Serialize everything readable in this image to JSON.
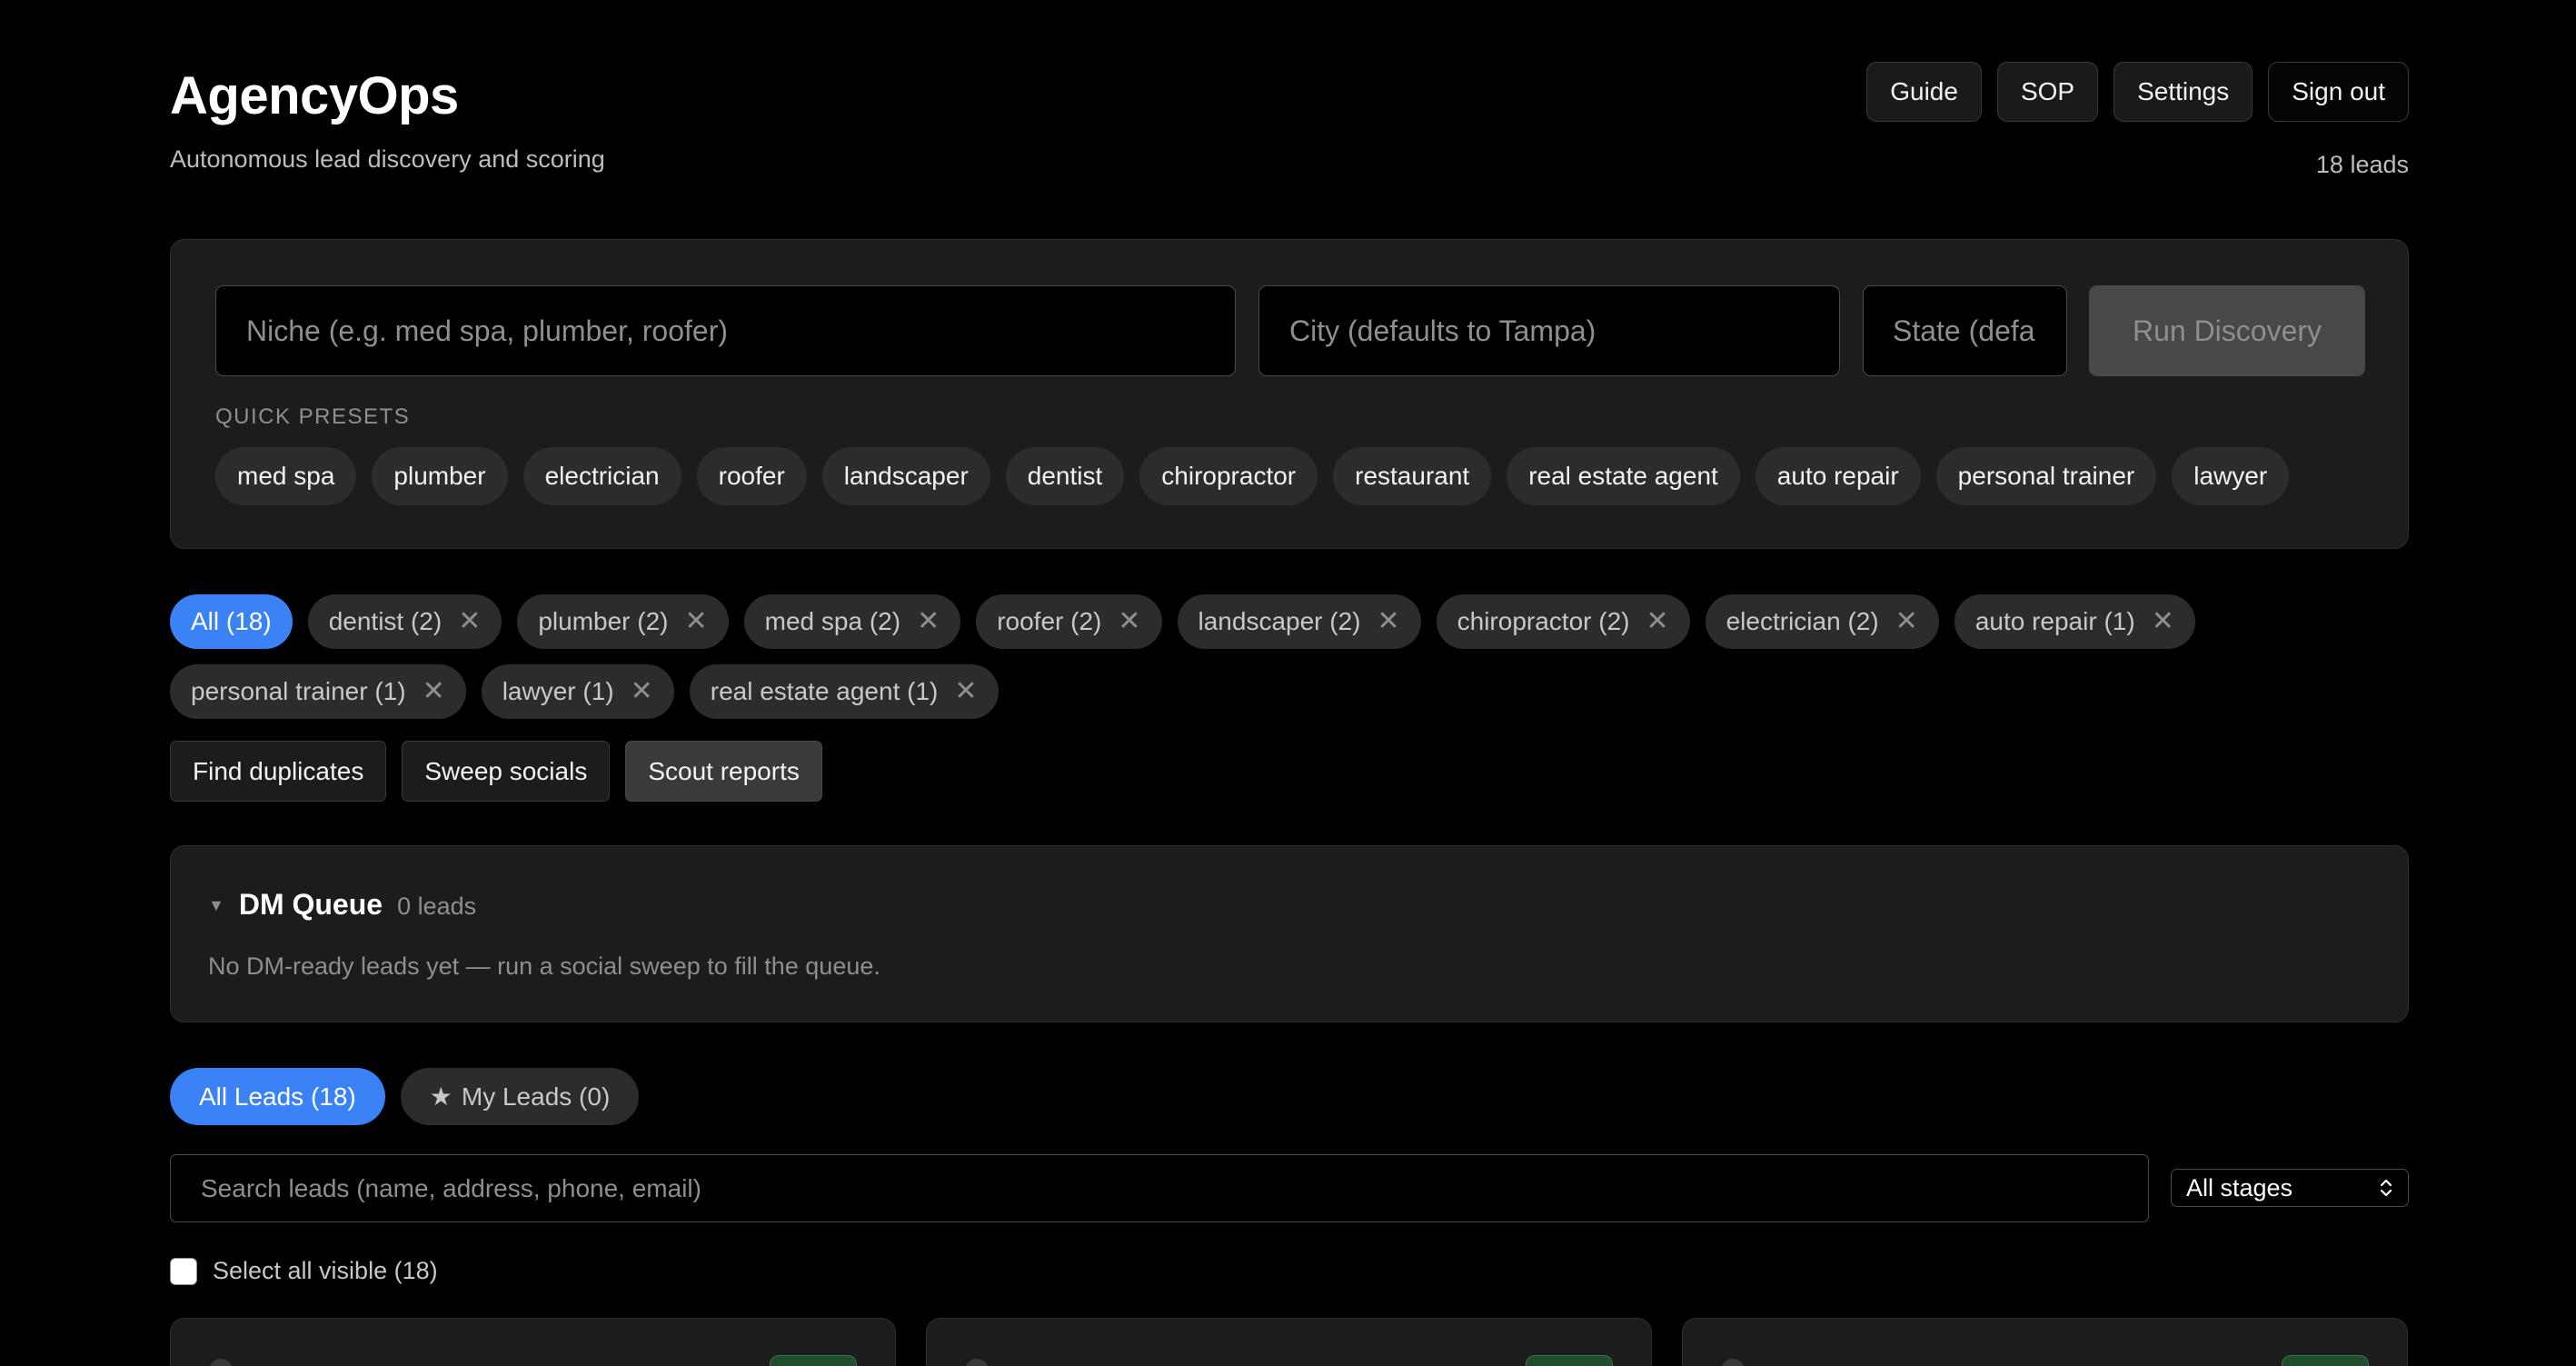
{
  "header": {
    "title": "AgencyOps",
    "subtitle": "Autonomous lead discovery and scoring",
    "nav": [
      "Guide",
      "SOP",
      "Settings",
      "Sign out"
    ],
    "lead_count": "18 leads"
  },
  "discovery": {
    "niche_placeholder": "Niche (e.g. med spa, plumber, roofer)",
    "city_placeholder": "City (defaults to Tampa)",
    "state_placeholder": "State (defa",
    "run_label": "Run Discovery",
    "presets_label": "QUICK PRESETS",
    "presets": [
      "med spa",
      "plumber",
      "electrician",
      "roofer",
      "landscaper",
      "dentist",
      "chiropractor",
      "restaurant",
      "real estate agent",
      "auto repair",
      "personal trainer",
      "lawyer"
    ]
  },
  "filters": {
    "all_label": "All (18)",
    "row1": [
      "dentist (2)",
      "plumber (2)",
      "med spa (2)",
      "roofer (2)",
      "landscaper (2)",
      "chiropractor (2)",
      "electrician (2)",
      "auto repair (1)"
    ],
    "row2": [
      "personal trainer (1)",
      "lawyer (1)",
      "real estate agent (1)"
    ],
    "close_glyph": "✕"
  },
  "actions": {
    "find_duplicates": "Find duplicates",
    "sweep_socials": "Sweep socials",
    "scout_reports": "Scout reports"
  },
  "dm_queue": {
    "caret": "▼",
    "title": "DM Queue",
    "count": "0 leads",
    "empty_message": "No DM-ready leads yet — run a social sweep to fill the queue."
  },
  "tabs": {
    "all_leads": "All Leads (18)",
    "my_leads_star": "★",
    "my_leads": "My Leads (0)"
  },
  "search": {
    "placeholder": "Search leads (name, address, phone, email)",
    "stage_value": "All stages"
  },
  "select_all": {
    "label": "Select all visible (18)"
  },
  "colors": {
    "background": "#000000",
    "panel": "#1c1c1e",
    "accent": "#3b82f6",
    "chip": "#2c2c2e",
    "badge_green": "#1f4d2e"
  }
}
